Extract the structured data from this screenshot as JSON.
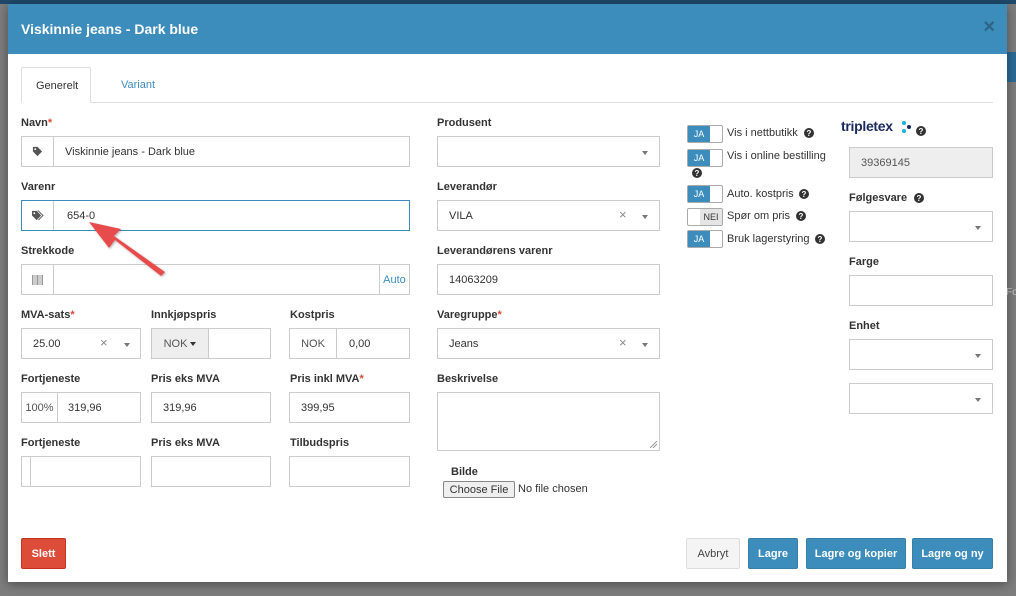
{
  "modal": {
    "title": "Viskinnie jeans - Dark blue",
    "close": "×"
  },
  "tabs": [
    {
      "label": "Generelt"
    },
    {
      "label": "Variant"
    }
  ],
  "fields": {
    "navn": {
      "label": "Navn",
      "value": "Viskinnie jeans - Dark blue",
      "required": "*"
    },
    "varenr": {
      "label": "Varenr",
      "value": "654-0"
    },
    "strekkode": {
      "label": "Strekkode",
      "value": "",
      "auto": "Auto"
    },
    "mva_sats": {
      "label": "MVA-sats",
      "value": "25.00",
      "required": "*"
    },
    "innkjopspris": {
      "label": "Innkjøpspris",
      "currency": "NOK",
      "value": ""
    },
    "kostpris": {
      "label": "Kostpris",
      "currency": "NOK",
      "value": "0,00"
    },
    "fortjeneste1": {
      "label": "Fortjeneste",
      "addon": "100%",
      "value": "319,96"
    },
    "pris_eks_mva1": {
      "label": "Pris eks MVA",
      "value": "319,96"
    },
    "pris_inkl_mva": {
      "label": "Pris inkl MVA",
      "value": "399,95",
      "required": "*"
    },
    "fortjeneste2": {
      "label": "Fortjeneste",
      "value": ""
    },
    "pris_eks_mva2": {
      "label": "Pris eks MVA",
      "value": ""
    },
    "tilbudspris": {
      "label": "Tilbudspris",
      "value": ""
    },
    "produsent": {
      "label": "Produsent",
      "value": ""
    },
    "leverandor": {
      "label": "Leverandør",
      "value": "VILA"
    },
    "leverandorens_varenr": {
      "label": "Leverandørens varenr",
      "value": "14063209"
    },
    "varegruppe": {
      "label": "Varegruppe",
      "value": "Jeans",
      "required": "*"
    },
    "beskrivelse": {
      "label": "Beskrivelse",
      "value": ""
    },
    "bilde": {
      "label": "Bilde",
      "button": "Choose File",
      "status": "No file chosen"
    },
    "tripletex_id": {
      "value": "39369145"
    },
    "folgesvare": {
      "label": "Følgesvare",
      "value": ""
    },
    "farge": {
      "label": "Farge",
      "value": ""
    },
    "enhet": {
      "label": "Enhet",
      "value": ""
    },
    "extra_select": {
      "value": ""
    }
  },
  "toggles": [
    {
      "state": "JA",
      "label": "Vis i nettbutikk"
    },
    {
      "state": "JA",
      "label": "Vis i online bestilling"
    },
    {
      "state": "JA",
      "label": "Auto. kostpris"
    },
    {
      "state": "NEI",
      "label": "Spør om pris"
    },
    {
      "state": "JA",
      "label": "Bruk lagerstyring"
    }
  ],
  "logo": {
    "text": "tripletex"
  },
  "buttons": {
    "slett": "Slett",
    "avbryt": "Avbryt",
    "lagre": "Lagre",
    "lagre_kopier": "Lagre og kopier",
    "lagre_ny": "Lagre og ny"
  },
  "background": {
    "right_text": "Fo"
  },
  "colors": {
    "primary": "#3c8dbc",
    "danger": "#dd4b39",
    "arrow": "#e84c4c"
  }
}
